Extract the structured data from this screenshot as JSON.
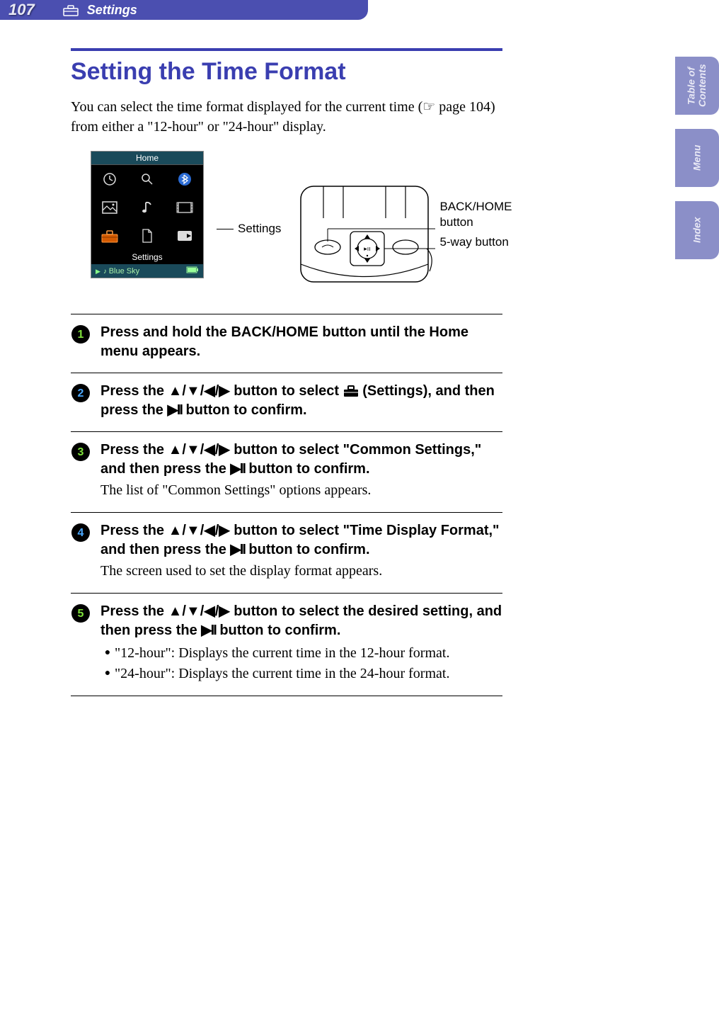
{
  "header": {
    "page_number": "107",
    "section_title": "Settings"
  },
  "side_tabs": {
    "toc": "Table of\nContents",
    "menu": "Menu",
    "index": "Index"
  },
  "main": {
    "title": "Setting the Time Format",
    "intro_pre": "You can select the time format displayed for the current time (",
    "intro_ref": " page 104",
    "intro_post": ") from either a \"12-hour\" or \"24-hour\" display."
  },
  "figure": {
    "home_label": "Home",
    "settings_label": "Settings",
    "now_playing": "Blue Sky",
    "callout_settings": "Settings",
    "device": {
      "back_home": "BACK/HOME",
      "button": "button",
      "five_way": "5-way button"
    }
  },
  "steps": {
    "s1": "Press and hold the BACK/HOME button until the Home menu appears.",
    "s2_a": "Press the ",
    "s2_arrows": "▲/▼/◀/▶",
    "s2_b": " button to select ",
    "s2_c": " (Settings), and then press the ",
    "s2_play": "▶II",
    "s2_d": " button to confirm.",
    "s3_a": "Press the ",
    "s3_b": " button to select \"Common Settings,\" and then press the ",
    "s3_c": " button to confirm.",
    "s3_detail": "The list of \"Common Settings\" options appears.",
    "s4_a": "Press the ",
    "s4_b": " button to select \"Time Display Format,\" and then press the ",
    "s4_c": " button to confirm.",
    "s4_detail": "The screen used to set the display format appears.",
    "s5_a": "Press the ",
    "s5_b": " button to select the desired setting, and then press the ",
    "s5_c": " button to confirm.",
    "s5_bullet1": "\"12-hour\": Displays the current time in the 12-hour format.",
    "s5_bullet2": "\"24-hour\": Displays the current time in the 24-hour format."
  }
}
